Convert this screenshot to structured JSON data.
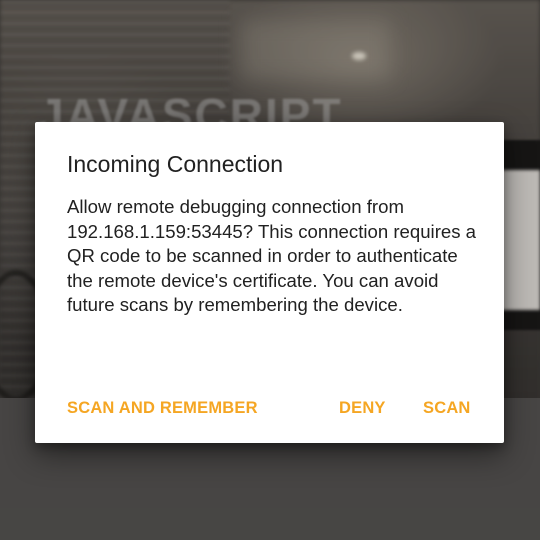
{
  "background": {
    "blurred_text": "JAVASCRIPT"
  },
  "dialog": {
    "title": "Incoming Connection",
    "message": "Allow remote debugging connection from 192.168.1.159:53445? This connection requires a QR code to be scanned in order to authenticate the remote device's certificate. You can avoid future scans by remembering the device.",
    "actions": {
      "scan_and_remember_label": "SCAN AND REMEMBER",
      "deny_label": "DENY",
      "scan_label": "SCAN"
    }
  },
  "colors": {
    "accent": "#f5a623",
    "dialog_background": "#ffffff",
    "text_primary": "#212121"
  }
}
